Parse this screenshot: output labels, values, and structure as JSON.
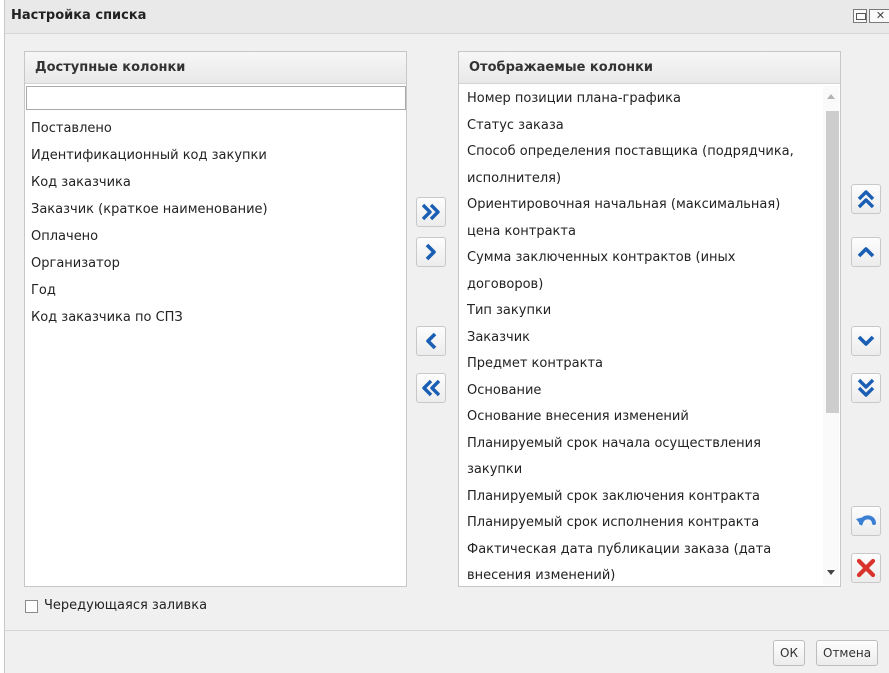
{
  "window": {
    "title": "Настройка списка"
  },
  "available": {
    "header": "Доступные колонки",
    "filter_value": "",
    "items": [
      "Поставлено",
      "Идентификационный код закупки",
      "Код заказчика",
      "Заказчик (краткое наименование)",
      "Оплачено",
      "Организатор",
      "Год",
      "Код заказчика по СПЗ"
    ]
  },
  "displayed": {
    "header": "Отображаемые колонки",
    "items": [
      "Номер позиции плана-графика",
      "Статус заказа",
      "Способ определения поставщика (подрядчика,",
      "исполнителя)",
      "Ориентировочная начальная (максимальная)",
      "цена контракта",
      "Сумма заключенных контрактов (иных",
      "договоров)",
      "Тип закупки",
      "Заказчик",
      "Предмет контракта",
      "Основание",
      "Основание внесения изменений",
      "Планируемый срок начала осуществления",
      "закупки",
      "Планируемый срок заключения контракта",
      "Планируемый срок исполнения контракта",
      "Фактическая дата публикации заказа (дата",
      "внесения изменений)"
    ]
  },
  "options": {
    "alternating_fill_label": "Чередующаяся заливка",
    "alternating_fill_checked": false
  },
  "footer": {
    "ok_label": "ОК",
    "cancel_label": "Отмена"
  },
  "colors": {
    "accent_blue": "#1a5fb4",
    "delete_red": "#d9342b"
  }
}
